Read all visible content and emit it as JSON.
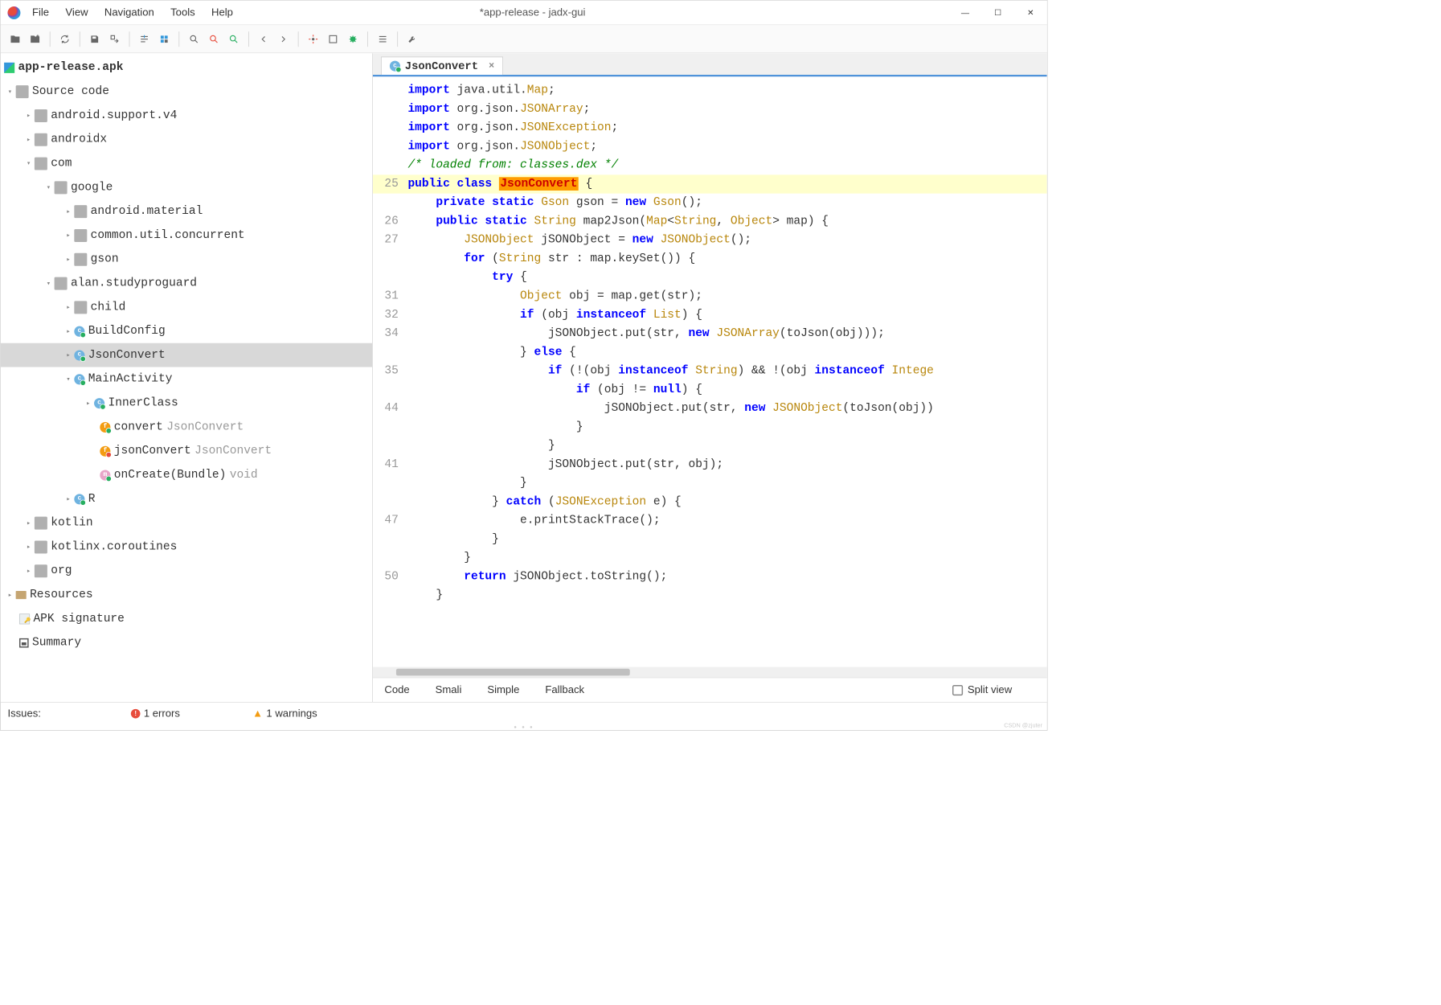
{
  "title": "*app-release - jadx-gui",
  "menu": [
    "File",
    "View",
    "Navigation",
    "Tools",
    "Help"
  ],
  "toolbar_icons": [
    "open-file-icon",
    "add-file-icon",
    "sync-icon",
    "save-icon",
    "export-icon",
    "jump-icon",
    "select-all-icon",
    "search-icon",
    "search-class-icon",
    "search-global-icon",
    "back-icon",
    "forward-icon",
    "settings-icon",
    "view-icon",
    "debug-icon",
    "list-icon",
    "tool-icon"
  ],
  "tree": {
    "root": "app-release.apk",
    "source_code": "Source code",
    "packages": {
      "android_support": "android.support.v4",
      "androidx": "androidx",
      "com": "com",
      "google": "google",
      "material": "android.material",
      "concurrent": "common.util.concurrent",
      "gson": "gson",
      "studyproguard": "alan.studyproguard",
      "child": "child",
      "buildconfig": "BuildConfig",
      "jsonconvert": "JsonConvert",
      "mainactivity": "MainActivity",
      "innerclass": "InnerClass",
      "convert": "convert",
      "convert_type": "JsonConvert",
      "jsonconvert_m": "jsonConvert",
      "jsonconvert_m_type": "JsonConvert",
      "oncreate": "onCreate(Bundle)",
      "oncreate_type": "void",
      "r": "R",
      "kotlin": "kotlin",
      "kotlinx": "kotlinx.coroutines",
      "org": "org"
    },
    "resources": "Resources",
    "apk_sig": "APK signature",
    "summary": "Summary"
  },
  "tab": {
    "label": "JsonConvert"
  },
  "code": {
    "lines": [
      {
        "n": "",
        "text": "import java.util.Map;",
        "tokens": [
          {
            "t": "import ",
            "c": "hl-import"
          },
          {
            "t": "java.util."
          },
          {
            "t": "Map",
            "c": "hl-type"
          },
          {
            "t": ";"
          }
        ]
      },
      {
        "n": "",
        "text": "import org.json.JSONArray;",
        "tokens": [
          {
            "t": "import ",
            "c": "hl-import"
          },
          {
            "t": "org.json."
          },
          {
            "t": "JSONArray",
            "c": "hl-type"
          },
          {
            "t": ";"
          }
        ]
      },
      {
        "n": "",
        "text": "import org.json.JSONException;",
        "tokens": [
          {
            "t": "import ",
            "c": "hl-import"
          },
          {
            "t": "org.json."
          },
          {
            "t": "JSONException",
            "c": "hl-type"
          },
          {
            "t": ";"
          }
        ]
      },
      {
        "n": "",
        "text": "import org.json.JSONObject;",
        "tokens": [
          {
            "t": "import ",
            "c": "hl-import"
          },
          {
            "t": "org.json."
          },
          {
            "t": "JSONObject",
            "c": "hl-type"
          },
          {
            "t": ";"
          }
        ]
      },
      {
        "n": "",
        "text": "",
        "tokens": []
      },
      {
        "n": "",
        "text": "/* loaded from: classes.dex */",
        "tokens": [
          {
            "t": "/* loaded from: classes.dex */",
            "c": "hl-comment"
          }
        ]
      },
      {
        "n": "25",
        "hl": true,
        "text": "public class JsonConvert {",
        "tokens": [
          {
            "t": "public class ",
            "c": "hl-kw"
          },
          {
            "t": "JsonConvert",
            "c": "hl-classname"
          },
          {
            "t": " {"
          }
        ]
      },
      {
        "n": "",
        "text": "    private static Gson gson = new Gson();",
        "tokens": [
          {
            "t": "    "
          },
          {
            "t": "private static ",
            "c": "hl-kw"
          },
          {
            "t": "Gson ",
            "c": "hl-type"
          },
          {
            "t": "gson = "
          },
          {
            "t": "new ",
            "c": "hl-kw"
          },
          {
            "t": "Gson",
            "c": "hl-type"
          },
          {
            "t": "();"
          }
        ]
      },
      {
        "n": "",
        "text": "",
        "tokens": []
      },
      {
        "n": "26",
        "text": "    public static String map2Json(Map<String, Object> map) {",
        "tokens": [
          {
            "t": "    "
          },
          {
            "t": "public static ",
            "c": "hl-kw"
          },
          {
            "t": "String ",
            "c": "hl-type"
          },
          {
            "t": "map2Json("
          },
          {
            "t": "Map",
            "c": "hl-type"
          },
          {
            "t": "<"
          },
          {
            "t": "String",
            "c": "hl-type"
          },
          {
            "t": ", "
          },
          {
            "t": "Object",
            "c": "hl-type"
          },
          {
            "t": "> map) {"
          }
        ]
      },
      {
        "n": "27",
        "text": "        JSONObject jSONObject = new JSONObject();",
        "tokens": [
          {
            "t": "        "
          },
          {
            "t": "JSONObject ",
            "c": "hl-type"
          },
          {
            "t": "jSONObject = "
          },
          {
            "t": "new ",
            "c": "hl-kw"
          },
          {
            "t": "JSONObject",
            "c": "hl-type"
          },
          {
            "t": "();"
          }
        ]
      },
      {
        "n": "",
        "text": "        for (String str : map.keySet()) {",
        "tokens": [
          {
            "t": "        "
          },
          {
            "t": "for ",
            "c": "hl-kw"
          },
          {
            "t": "("
          },
          {
            "t": "String ",
            "c": "hl-type"
          },
          {
            "t": "str : map.keySet()) {"
          }
        ]
      },
      {
        "n": "",
        "text": "            try {",
        "tokens": [
          {
            "t": "            "
          },
          {
            "t": "try ",
            "c": "hl-kw"
          },
          {
            "t": "{"
          }
        ]
      },
      {
        "n": "31",
        "text": "                Object obj = map.get(str);",
        "tokens": [
          {
            "t": "                "
          },
          {
            "t": "Object ",
            "c": "hl-type"
          },
          {
            "t": "obj = map.get(str);"
          }
        ]
      },
      {
        "n": "32",
        "text": "                if (obj instanceof List) {",
        "tokens": [
          {
            "t": "                "
          },
          {
            "t": "if ",
            "c": "hl-kw"
          },
          {
            "t": "(obj "
          },
          {
            "t": "instanceof ",
            "c": "hl-kw"
          },
          {
            "t": "List",
            "c": "hl-type"
          },
          {
            "t": ") {"
          }
        ]
      },
      {
        "n": "34",
        "text": "                    jSONObject.put(str, new JSONArray(toJson(obj)));",
        "tokens": [
          {
            "t": "                    jSONObject.put(str, "
          },
          {
            "t": "new ",
            "c": "hl-kw"
          },
          {
            "t": "JSONArray",
            "c": "hl-type"
          },
          {
            "t": "(toJson(obj)));"
          }
        ]
      },
      {
        "n": "",
        "text": "                } else {",
        "tokens": [
          {
            "t": "                } "
          },
          {
            "t": "else ",
            "c": "hl-kw"
          },
          {
            "t": "{"
          }
        ]
      },
      {
        "n": "35",
        "text": "                    if (!(obj instanceof String) && !(obj instanceof Intege",
        "tokens": [
          {
            "t": "                    "
          },
          {
            "t": "if ",
            "c": "hl-kw"
          },
          {
            "t": "(!(obj "
          },
          {
            "t": "instanceof ",
            "c": "hl-kw"
          },
          {
            "t": "String",
            "c": "hl-type"
          },
          {
            "t": ") && !(obj "
          },
          {
            "t": "instanceof ",
            "c": "hl-kw"
          },
          {
            "t": "Intege",
            "c": "hl-type"
          }
        ]
      },
      {
        "n": "",
        "text": "                        if (obj != null) {",
        "tokens": [
          {
            "t": "                        "
          },
          {
            "t": "if ",
            "c": "hl-kw"
          },
          {
            "t": "(obj != "
          },
          {
            "t": "null",
            "c": "hl-kw"
          },
          {
            "t": ") {"
          }
        ]
      },
      {
        "n": "44",
        "text": "                            jSONObject.put(str, new JSONObject(toJson(obj))",
        "tokens": [
          {
            "t": "                            jSONObject.put(str, "
          },
          {
            "t": "new ",
            "c": "hl-kw"
          },
          {
            "t": "JSONObject",
            "c": "hl-type"
          },
          {
            "t": "(toJson(obj))"
          }
        ]
      },
      {
        "n": "",
        "text": "                        }",
        "tokens": [
          {
            "t": "                        }"
          }
        ]
      },
      {
        "n": "",
        "text": "                    }",
        "tokens": [
          {
            "t": "                    }"
          }
        ]
      },
      {
        "n": "41",
        "text": "                    jSONObject.put(str, obj);",
        "tokens": [
          {
            "t": "                    jSONObject.put(str, obj);"
          }
        ]
      },
      {
        "n": "",
        "text": "                }",
        "tokens": [
          {
            "t": "                }"
          }
        ]
      },
      {
        "n": "",
        "text": "            } catch (JSONException e) {",
        "tokens": [
          {
            "t": "            } "
          },
          {
            "t": "catch ",
            "c": "hl-kw"
          },
          {
            "t": "("
          },
          {
            "t": "JSONException ",
            "c": "hl-type"
          },
          {
            "t": "e) {"
          }
        ]
      },
      {
        "n": "47",
        "text": "                e.printStackTrace();",
        "tokens": [
          {
            "t": "                e.printStackTrace();"
          }
        ]
      },
      {
        "n": "",
        "text": "            }",
        "tokens": [
          {
            "t": "            }"
          }
        ]
      },
      {
        "n": "",
        "text": "        }",
        "tokens": [
          {
            "t": "        }"
          }
        ]
      },
      {
        "n": "50",
        "text": "        return jSONObject.toString();",
        "tokens": [
          {
            "t": "        "
          },
          {
            "t": "return ",
            "c": "hl-kw"
          },
          {
            "t": "jSONObject.toString();"
          }
        ]
      },
      {
        "n": "",
        "text": "    }",
        "tokens": [
          {
            "t": "    }"
          }
        ]
      }
    ]
  },
  "bottom_tabs": [
    "Code",
    "Smali",
    "Simple",
    "Fallback"
  ],
  "split_view": "Split view",
  "status": {
    "issues": "Issues:",
    "errors": "1 errors",
    "warnings": "1 warnings"
  },
  "watermark": "CSDN @zjuter"
}
